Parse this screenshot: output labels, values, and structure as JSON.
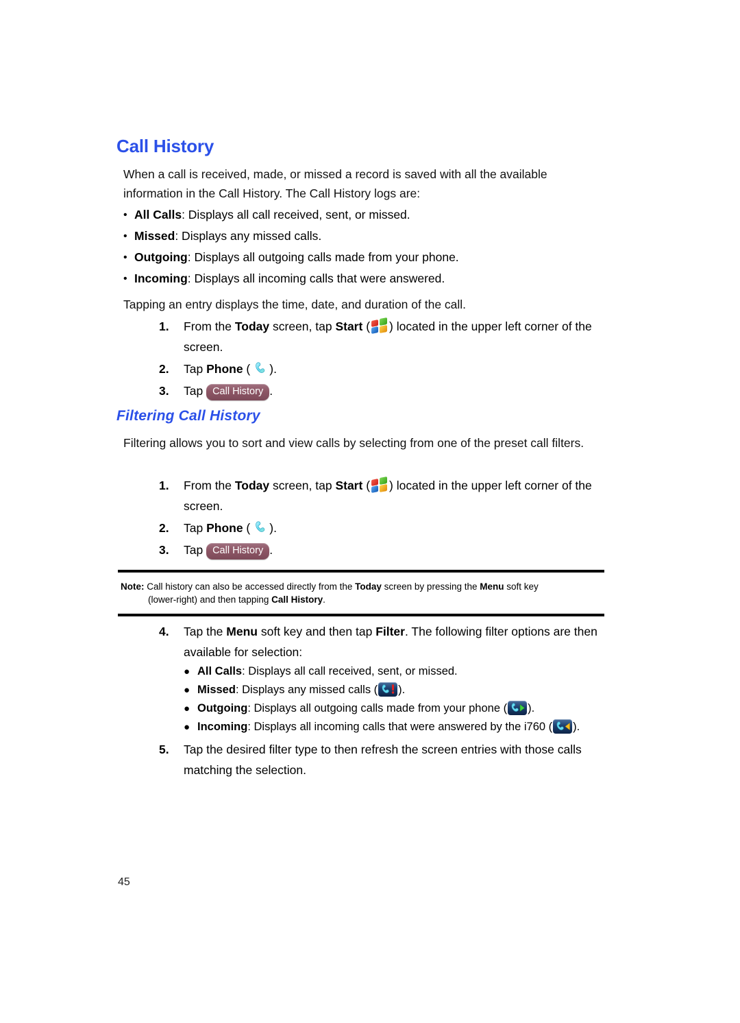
{
  "document": {
    "page_number": "45"
  },
  "section": {
    "title": "Call History",
    "intro": "When a call is received, made, or missed a record is saved with all the available information in the Call History. The Call History logs are:",
    "log_types": [
      {
        "term": "All Calls",
        "desc": ": Displays all call received, sent, or missed."
      },
      {
        "term": "Missed",
        "desc": ": Displays any missed calls."
      },
      {
        "term": "Outgoing",
        "desc": ": Displays all outgoing calls made from your phone."
      },
      {
        "term": "Incoming",
        "desc": ": Displays all incoming calls that were answered."
      }
    ],
    "after_list": "Tapping an entry displays the time, date, and duration of the call.",
    "steps": [
      {
        "num": "1.",
        "t1": "From the ",
        "b1": "Today",
        "t2": " screen, tap ",
        "b2": "Start",
        "t3": " (",
        "icon": "windows-start-icon",
        "t4": ") located in the upper left corner of the screen."
      },
      {
        "num": "2.",
        "t1": "Tap ",
        "b1": "Phone",
        "t2": " (",
        "icon": "phone-handset-icon",
        "t3": ")."
      },
      {
        "num": "3.",
        "t1": "Tap ",
        "button_label": "Call History",
        "t2": "."
      }
    ]
  },
  "filtering": {
    "title": "Filtering Call History",
    "intro": "Filtering allows you to sort and view calls by selecting from one of the preset call filters.",
    "steps": [
      {
        "num": "1.",
        "t1": "From the ",
        "b1": "Today",
        "t2": " screen, tap ",
        "b2": "Start",
        "t3": " (",
        "icon": "windows-start-icon",
        "t4": ") located in the upper left corner of the screen."
      },
      {
        "num": "2.",
        "t1": "Tap ",
        "b1": "Phone",
        "t2": " (",
        "icon": "phone-handset-icon",
        "t3": ")."
      },
      {
        "num": "3.",
        "t1": "Tap ",
        "button_label": "Call History",
        "t2": "."
      }
    ],
    "note": {
      "label": "Note:",
      "line1_a": " Call history can also be accessed directly from the ",
      "line1_b": "Today",
      "line1_c": " screen by pressing the ",
      "line1_d": "Menu",
      "line1_e": " soft key",
      "line2_a": "(lower-right) and then tapping ",
      "line2_b": "Call History",
      "line2_c": "."
    },
    "step4": {
      "num": "4.",
      "t1": "Tap the ",
      "b1": "Menu",
      "t2": " soft key and then tap ",
      "b2": "Filter",
      "t3": ". The following filter options are then available for selection:"
    },
    "filter_options": [
      {
        "term": "All Calls",
        "desc": ": Displays all call received, sent, or missed.",
        "icon": "",
        "tail": ""
      },
      {
        "term": "Missed",
        "desc": ": Displays any missed calls (",
        "icon": "missed-call-icon",
        "tail": ")."
      },
      {
        "term": "Outgoing",
        "desc": ": Displays all outgoing calls made from your phone (",
        "icon": "outgoing-call-icon",
        "tail": ")."
      },
      {
        "term": "Incoming",
        "desc": ": Displays all incoming calls that were answered by the i760 (",
        "icon": "incoming-call-icon",
        "tail": ")."
      }
    ],
    "step5": {
      "num": "5.",
      "text": "Tap the desired filter type to then refresh the screen entries with those calls matching the selection."
    }
  },
  "colors": {
    "heading_blue": "#2b50e8",
    "pill_mauve": "#8d5665",
    "icon_plate_blue": "#1d3f6e",
    "handset_cyan": "#6fe3f5",
    "missed_red": "#d81f1f",
    "outgoing_green": "#3fc23f",
    "incoming_yellow": "#f0b417"
  }
}
